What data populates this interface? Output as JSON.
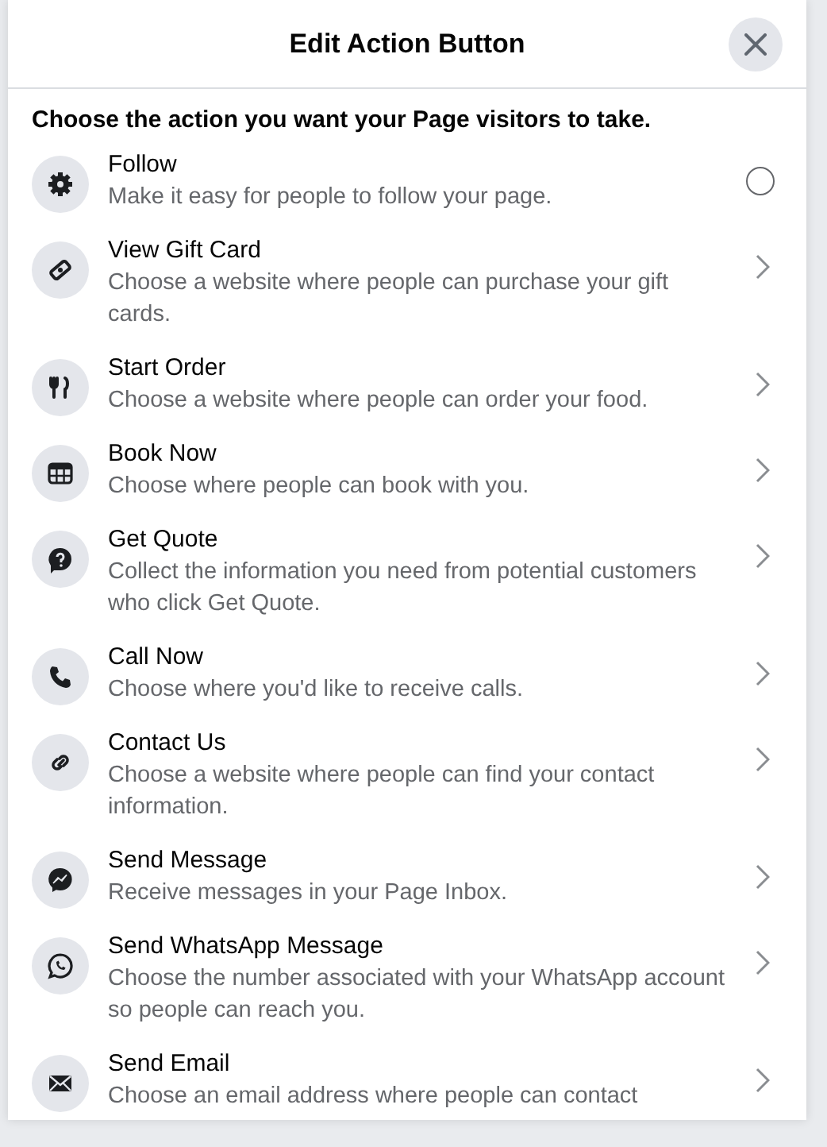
{
  "dialog": {
    "title": "Edit Action Button",
    "prompt": "Choose the action you want your Page visitors to take.",
    "actions": [
      {
        "kind": "radio",
        "title": "Follow",
        "description": "Make it easy for people to follow your page.",
        "selected": false
      },
      {
        "kind": "chevron",
        "title": "View Gift Card",
        "description": "Choose a website where people can purchase your gift cards."
      },
      {
        "kind": "chevron",
        "title": "Start Order",
        "description": "Choose a website where people can order your food."
      },
      {
        "kind": "chevron",
        "title": "Book Now",
        "description": "Choose where people can book with you."
      },
      {
        "kind": "chevron",
        "title": "Get Quote",
        "description": "Collect the information you need from potential customers who click Get Quote."
      },
      {
        "kind": "chevron",
        "title": "Call Now",
        "description": "Choose where you'd like to receive calls."
      },
      {
        "kind": "chevron",
        "title": "Contact Us",
        "description": "Choose a website where people can find your contact information."
      },
      {
        "kind": "chevron",
        "title": "Send Message",
        "description": "Receive messages in your Page Inbox."
      },
      {
        "kind": "chevron",
        "title": "Send WhatsApp Message",
        "description": "Choose the number associated with your WhatsApp account so people can reach you."
      },
      {
        "kind": "chevron",
        "title": "Send Email",
        "description": "Choose an email address where people can contact"
      }
    ]
  }
}
